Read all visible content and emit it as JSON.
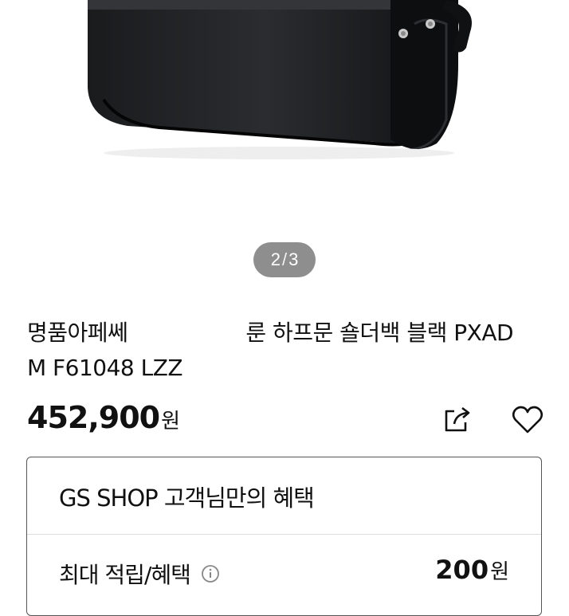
{
  "carousel": {
    "current": "2",
    "separator": "/",
    "total": "3"
  },
  "product": {
    "title_part1": "명품아페쎄",
    "title_part2": "룬 하프문 숄더백 블랙 PXAD",
    "title_line2": "M F61048 LZZ",
    "price": "452,900",
    "price_unit": "원"
  },
  "actions": {
    "share_icon": "share-icon",
    "like_icon": "heart-icon"
  },
  "benefits": {
    "title": "GS SHOP 고객님만의 혜택",
    "row_label": "최대 적립/혜택",
    "row_value": "200",
    "row_unit": "원"
  },
  "colors": {
    "indicator_bg": "#8e8e8e",
    "text": "#111111",
    "box_border": "#555555"
  }
}
